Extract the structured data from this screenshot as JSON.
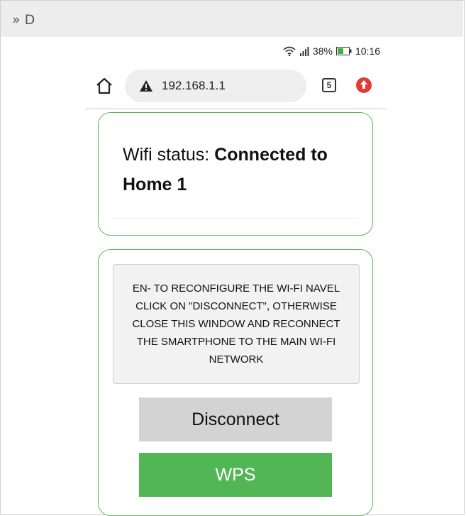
{
  "window": {
    "title": "» D"
  },
  "status_bar": {
    "battery": "38%",
    "time": "10:16"
  },
  "browser": {
    "url": "192.168.1.1",
    "tab_count": "5"
  },
  "wifi_card": {
    "status_label": "Wifi status:",
    "status_value": "Connected to Home 1"
  },
  "action_card": {
    "message": "EN- TO RECONFIGURE THE WI-FI NAVEL CLICK ON \"DISCONNECT\", OTHERWISE CLOSE THIS WINDOW AND RECONNECT THE SMARTPHONE TO THE MAIN WI-FI NETWORK",
    "disconnect_label": "Disconnect",
    "wps_label": "WPS"
  },
  "colors": {
    "accent_green": "#52b655",
    "border_green": "#5cb85c",
    "update_red": "#e53935"
  },
  "icons": {
    "home": "home-icon",
    "warning": "warning-icon",
    "tabs": "tabs-icon",
    "update": "update-icon",
    "wifi": "wifi-icon",
    "signal": "signal-icon",
    "battery": "battery-icon"
  }
}
